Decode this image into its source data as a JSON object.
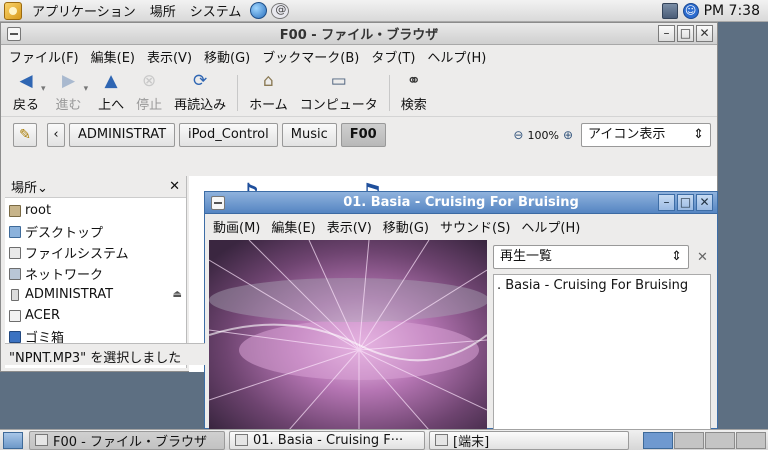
{
  "top_panel": {
    "menus": [
      "アプリケーション",
      "場所",
      "システム"
    ],
    "clock": "PM 7:38"
  },
  "file_browser": {
    "title": "F00 - ファイル・ブラウザ",
    "menu": [
      "ファイル(F)",
      "編集(E)",
      "表示(V)",
      "移動(G)",
      "ブックマーク(B)",
      "タブ(T)",
      "ヘルプ(H)"
    ],
    "toolbar": {
      "back": "戻る",
      "forward": "進む",
      "up": "上へ",
      "stop": "停止",
      "reload": "再読込み",
      "home": "ホーム",
      "computer": "コンピュータ",
      "search": "検索"
    },
    "breadcrumbs": [
      "ADMINISTRAT",
      "iPod_Control",
      "Music",
      "F00"
    ],
    "zoom": "100%",
    "view_mode": "アイコン表示",
    "sidebar": {
      "header": "場所",
      "items": [
        "root",
        "デスクトップ",
        "ファイルシステム",
        "ネットワーク",
        "ADMINISTRAT",
        "ACER",
        "ゴミ箱"
      ]
    },
    "status": "\"NPNT.MP3\" を選択しました"
  },
  "player": {
    "title": "01. Basia - Cruising For Bruising",
    "menu": [
      "動画(M)",
      "編集(E)",
      "表示(V)",
      "移動(G)",
      "サウンド(S)",
      "ヘルプ(H)"
    ],
    "playlist_select": "再生一覧",
    "playlist_items": [
      ". Basia - Cruising For Bruising"
    ]
  },
  "taskbar": {
    "tasks": [
      "F00 - ファイル・ブラウザ",
      "01. Basia - Cruising F···",
      "[端末]"
    ]
  }
}
